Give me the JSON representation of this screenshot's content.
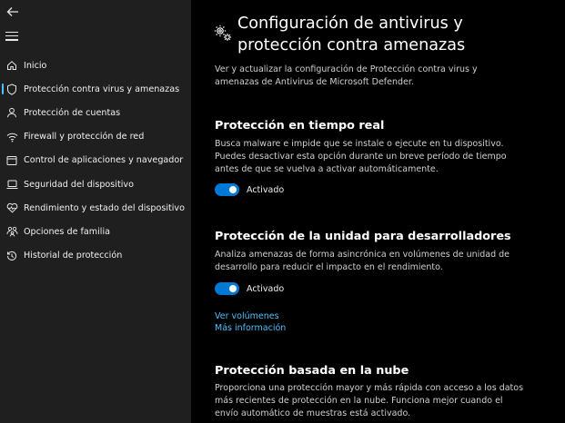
{
  "sidebar": {
    "back_icon": "back-arrow-icon",
    "menu_icon": "hamburger-menu-icon",
    "items": [
      {
        "label": "Inicio",
        "icon": "home-icon"
      },
      {
        "label": "Protección contra virus y amenazas",
        "icon": "shield-icon",
        "active": true
      },
      {
        "label": "Protección de cuentas",
        "icon": "person-icon"
      },
      {
        "label": "Firewall y protección de red",
        "icon": "wifi-icon"
      },
      {
        "label": "Control de aplicaciones y navegador",
        "icon": "app-window-icon"
      },
      {
        "label": "Seguridad del dispositivo",
        "icon": "laptop-icon"
      },
      {
        "label": "Rendimiento y estado del dispositivo",
        "icon": "heart-icon"
      },
      {
        "label": "Opciones de familia",
        "icon": "family-icon"
      },
      {
        "label": "Historial de protección",
        "icon": "history-icon"
      }
    ],
    "accent": "#4cc2ff"
  },
  "main": {
    "header_icon": "gears-icon",
    "title": "Configuración de antivirus y protección contra amenazas",
    "intro": "Ver y actualizar la configuración de Protección contra virus y amenazas de Antivirus de Microsoft Defender.",
    "sections": [
      {
        "title": "Protección en tiempo real",
        "description": "Busca malware e impide que se instale o ejecute en tu dispositivo. Puedes desactivar esta opción durante un breve período de tiempo antes de que se vuelva a activar automáticamente.",
        "toggle_label": "Activado",
        "toggle_on": true
      },
      {
        "title": "Protección de la unidad para desarrolladores",
        "description": "Analiza amenazas de forma asincrónica en volúmenes de unidad de desarrollo para reducir el impacto en el rendimiento.",
        "toggle_label": "Activado",
        "toggle_on": true,
        "links": [
          "Ver volúmenes",
          "Más información"
        ]
      },
      {
        "title": "Protección basada en la nube",
        "description": "Proporciona una protección mayor y más rápida con acceso a los datos más recientes de protección en la nube. Funciona mejor cuando el envío automático de muestras está activado."
      }
    ],
    "toggle_color": "#0078d4",
    "link_color": "#4cc2ff"
  }
}
